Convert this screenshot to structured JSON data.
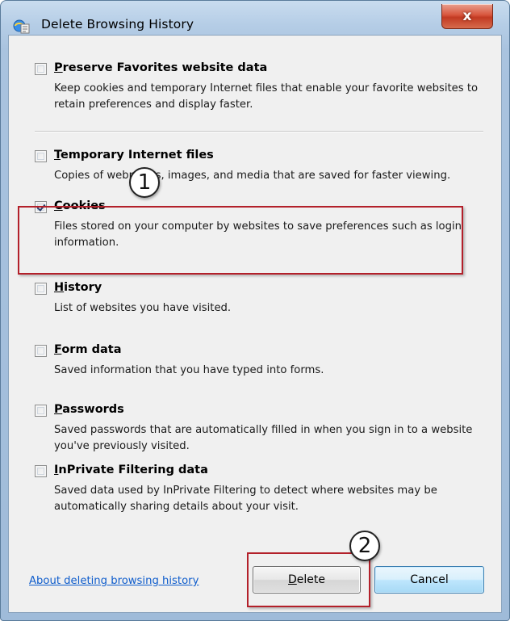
{
  "window": {
    "title": "Delete Browsing History",
    "close_glyph": "x"
  },
  "items": [
    {
      "label_first": "P",
      "label_rest": "reserve Favorites website data",
      "description": "Keep cookies and temporary Internet files that enable your favorite websites to retain preferences and display faster.",
      "checked": false
    },
    {
      "label_first": "T",
      "label_rest": "emporary Internet files",
      "description": "Copies of webpages, images, and media that are saved for faster viewing.",
      "checked": false
    },
    {
      "label_first": "C",
      "label_rest": "ookies",
      "description": "Files stored on your computer by websites to save preferences such as login information.",
      "checked": true
    },
    {
      "label_first": "H",
      "label_rest": "istory",
      "description": "List of websites you have visited.",
      "checked": false
    },
    {
      "label_first": "F",
      "label_rest": "orm data",
      "description": "Saved information that you have typed into forms.",
      "checked": false
    },
    {
      "label_first": "P",
      "label_rest": "asswords",
      "description": "Saved passwords that are automatically filled in when you sign in to a website you've previously visited.",
      "checked": false
    },
    {
      "label_first": "I",
      "label_rest": "nPrivate Filtering data",
      "description": "Saved data used by InPrivate Filtering to detect where websites may be automatically sharing details about your visit.",
      "checked": false
    }
  ],
  "footer": {
    "help_link": "About deleting browsing history",
    "delete_first": "D",
    "delete_rest": "elete",
    "cancel_label": "Cancel"
  },
  "annotations": {
    "callout_1": "1",
    "callout_2": "2",
    "highlight_color": "#b3202a"
  },
  "icons": {
    "app": "ie-delete-history-icon",
    "close": "close-icon"
  }
}
